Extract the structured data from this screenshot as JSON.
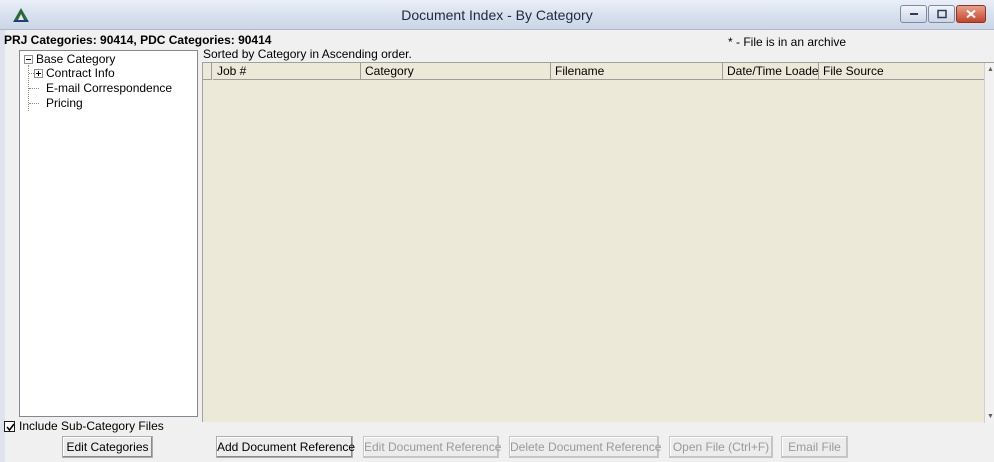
{
  "window": {
    "title": "Document Index - By Category",
    "controls": [
      "minimize",
      "maximize",
      "close"
    ]
  },
  "header": {
    "categories": "PRJ Categories: 90414, PDC Categories: 90414",
    "archive_note": "* - File is in an archive",
    "sort_note": "Sorted by Category in Ascending order."
  },
  "tree": {
    "root": "Base Category",
    "items": [
      {
        "label": "Contract Info",
        "expandable": true
      },
      {
        "label": "E-mail Correspondence",
        "expandable": false
      },
      {
        "label": "Pricing",
        "expandable": false
      }
    ]
  },
  "grid": {
    "columns": [
      "Job #",
      "Category",
      "Filename",
      "Date/Time Loaded",
      "File Source"
    ],
    "rows": []
  },
  "options": {
    "include_subcategory_label": "Include Sub-Category Files",
    "include_subcategory_checked": true
  },
  "buttons": {
    "edit_categories": "Edit Categories",
    "add_document_reference": "Add Document Reference",
    "edit_document_reference": "Edit Document Reference",
    "delete_document_reference": "Delete Document Reference",
    "open_file": "Open File (Ctrl+F)",
    "email_file": "Email File"
  },
  "icons": {
    "app": "app-logo-icon",
    "tree_collapse": "minus-box-icon",
    "tree_expand": "plus-box-icon"
  },
  "colors": {
    "grid_background": "#ece9d8",
    "titlebar": "#d6e0ee",
    "close_button": "#c6432a",
    "disabled_text": "#9a9a9a"
  }
}
